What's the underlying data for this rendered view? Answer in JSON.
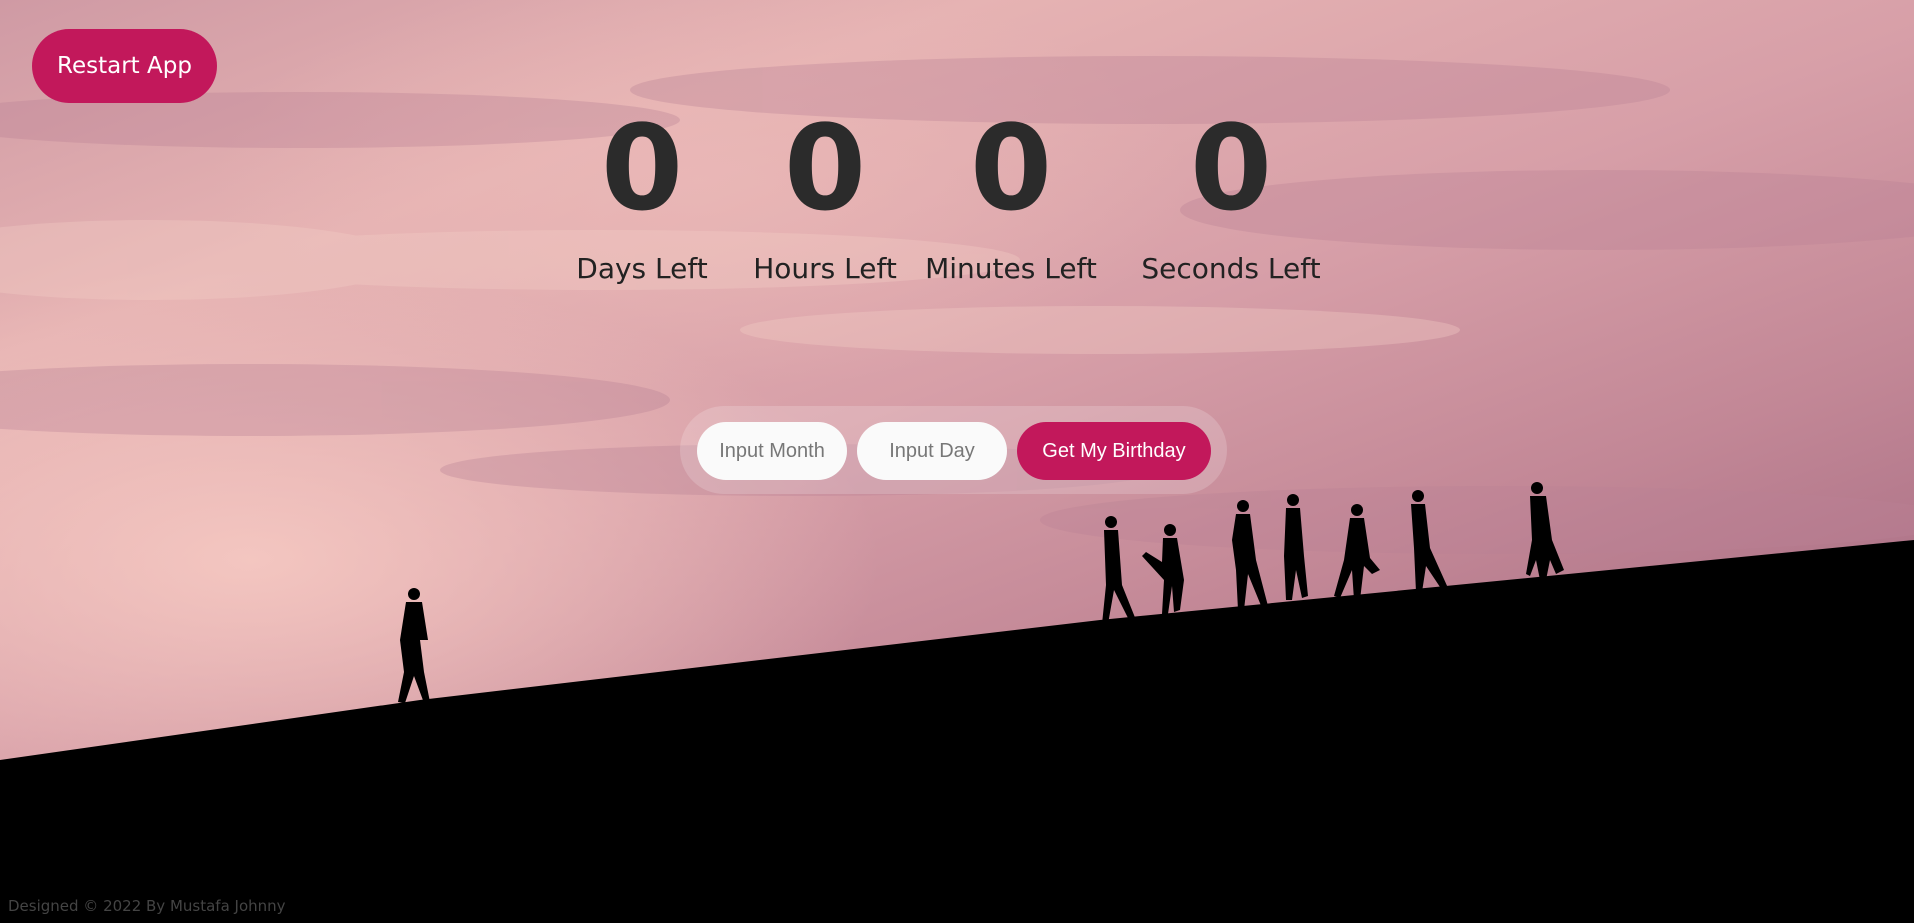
{
  "header": {
    "restart_label": "Restart App"
  },
  "countdown": {
    "days": {
      "value": "0",
      "label": "Days Left"
    },
    "hours": {
      "value": "0",
      "label": "Hours Left"
    },
    "minutes": {
      "value": "0",
      "label": "Minutes Left"
    },
    "seconds": {
      "value": "0",
      "label": "Seconds Left"
    }
  },
  "form": {
    "month_placeholder": "Input Month",
    "day_placeholder": "Input Day",
    "submit_label": "Get My Birthday"
  },
  "footer": {
    "credit": "Designed © 2022 By Mustafa Johnny"
  },
  "colors": {
    "accent": "#c2185b",
    "digit": "#2b2b2b",
    "sky_light": "#e6b3b3",
    "sky_dark": "#8a5674",
    "ground": "#000000"
  }
}
